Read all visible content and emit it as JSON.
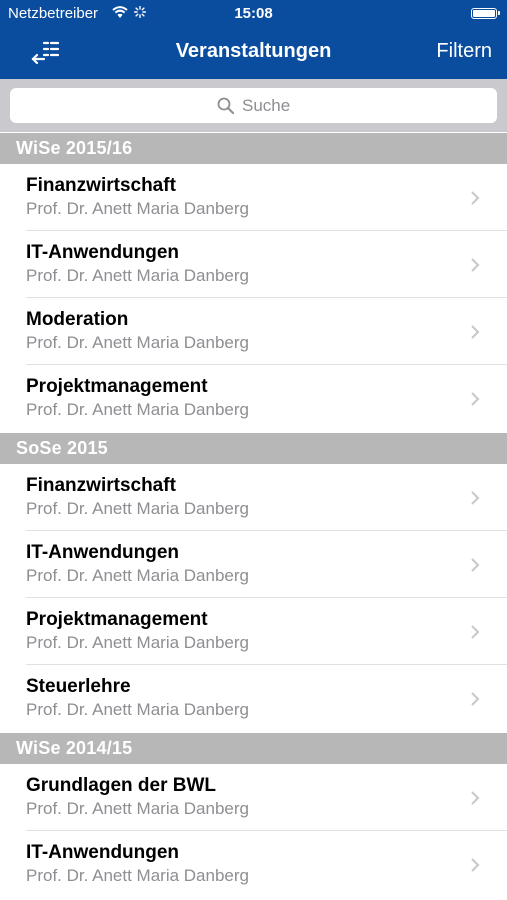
{
  "status": {
    "carrier": "Netzbetreiber",
    "time": "15:08"
  },
  "nav": {
    "title": "Veranstaltungen",
    "filter_label": "Filtern"
  },
  "search": {
    "placeholder": "Suche"
  },
  "sections": [
    {
      "title": "WiSe 2015/16",
      "items": [
        {
          "title": "Finanzwirtschaft",
          "subtitle": "Prof. Dr. Anett Maria Danberg"
        },
        {
          "title": "IT-Anwendungen",
          "subtitle": "Prof. Dr. Anett Maria Danberg"
        },
        {
          "title": "Moderation",
          "subtitle": "Prof. Dr. Anett Maria Danberg"
        },
        {
          "title": "Projektmanagement",
          "subtitle": "Prof. Dr. Anett Maria Danberg"
        }
      ]
    },
    {
      "title": "SoSe 2015",
      "items": [
        {
          "title": "Finanzwirtschaft",
          "subtitle": "Prof. Dr. Anett Maria Danberg"
        },
        {
          "title": "IT-Anwendungen",
          "subtitle": "Prof. Dr. Anett Maria Danberg"
        },
        {
          "title": "Projektmanagement",
          "subtitle": "Prof. Dr. Anett Maria Danberg"
        },
        {
          "title": "Steuerlehre",
          "subtitle": "Prof. Dr. Anett Maria Danberg"
        }
      ]
    },
    {
      "title": "WiSe 2014/15",
      "items": [
        {
          "title": "Grundlagen der BWL",
          "subtitle": "Prof. Dr. Anett Maria Danberg"
        },
        {
          "title": "IT-Anwendungen",
          "subtitle": "Prof. Dr. Anett Maria Danberg"
        }
      ]
    }
  ],
  "colors": {
    "nav_bar": "#0a4d9f",
    "section_header": "#b7b7b7",
    "subtitle": "#8e8e93"
  },
  "icons": {
    "menu": "menu-list-icon",
    "search": "search-icon",
    "disclosure": "chevron-right-icon",
    "wifi": "wifi-icon",
    "activity": "activity-spinner-icon",
    "battery": "battery-icon"
  }
}
